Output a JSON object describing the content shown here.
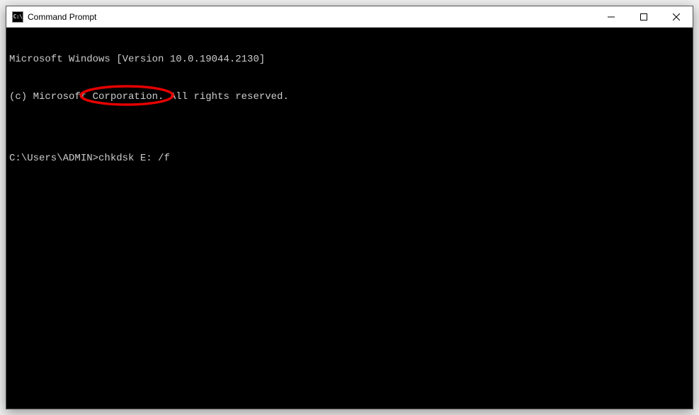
{
  "window": {
    "title": "Command Prompt",
    "icon_label": "C:\\"
  },
  "controls": {
    "minimize": "Minimize",
    "maximize": "Maximize",
    "close": "Close"
  },
  "terminal": {
    "lines": [
      "Microsoft Windows [Version 10.0.19044.2130]",
      "(c) Microsoft Corporation. All rights reserved.",
      ""
    ],
    "prompt": "C:\\Users\\ADMIN>",
    "command": "chkdsk E: /f"
  },
  "annotation": {
    "highlight_color": "#e60000"
  }
}
